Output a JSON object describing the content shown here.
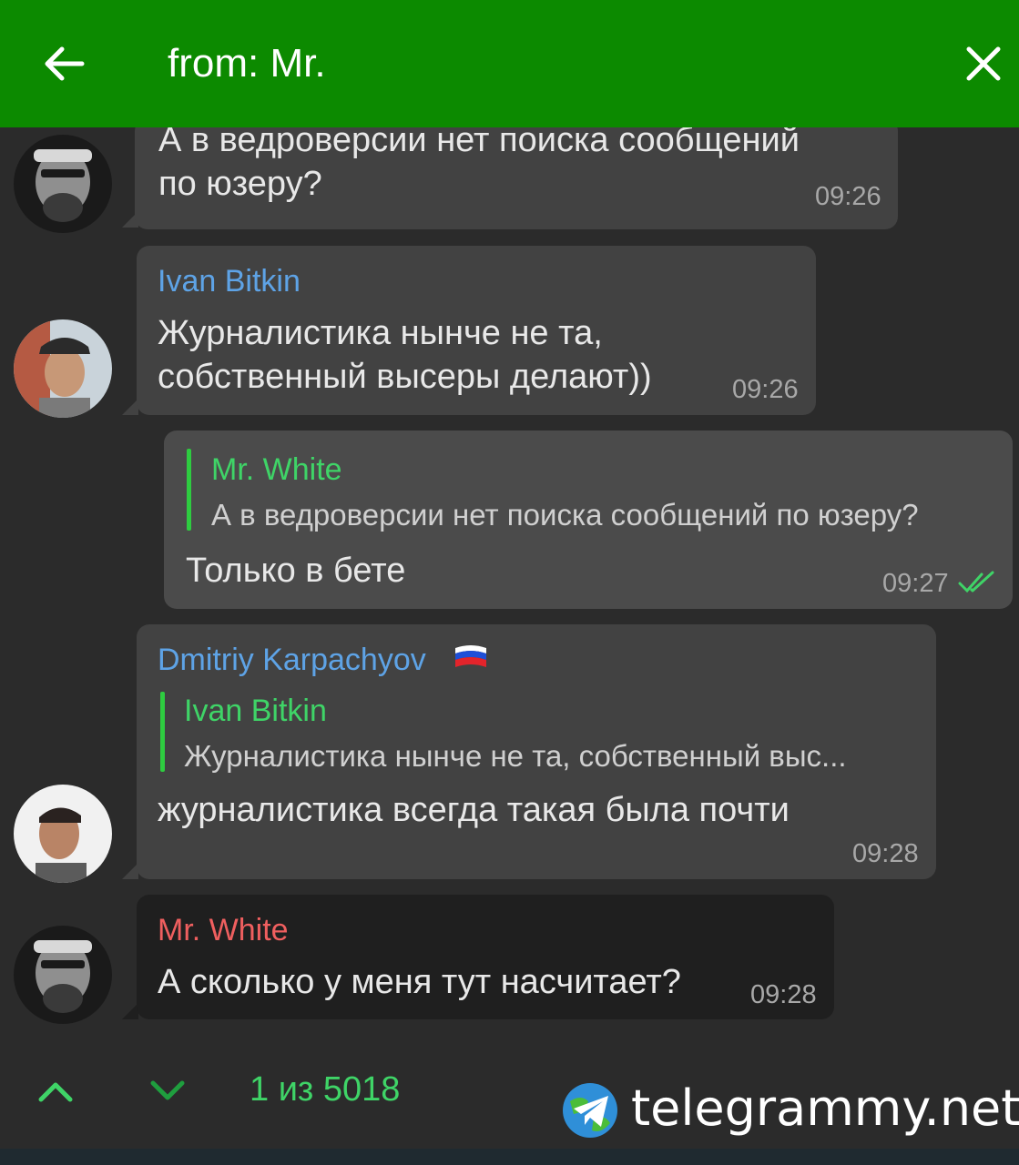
{
  "header": {
    "search_value": "from: Mr.",
    "back_icon": "arrow-left-icon",
    "close_icon": "close-icon",
    "background": "#0c8a00"
  },
  "messages": [
    {
      "text_line1": "А в ведроверсии нет поиска сообщений",
      "text_line2": "по юзеру?",
      "time": "09:26"
    },
    {
      "sender": "Ivan Bitkin",
      "text_line1": "Журналистика нынче не та,",
      "text_line2": "собственный высеры делают))",
      "time": "09:26"
    },
    {
      "reply_name": "Mr. White",
      "reply_text": "А в ведроверсии нет поиска сообщений по юзеру?",
      "text": "Только в бете",
      "time": "09:27",
      "status_icon": "double-check-icon"
    },
    {
      "sender": "Dmitriy Karpachyov",
      "sender_flag": "russia-flag-icon",
      "reply_name": "Ivan Bitkin",
      "reply_text": "Журналистика нынче не та, собственный выс...",
      "text": "журналистика всегда такая была почти",
      "time": "09:28"
    },
    {
      "sender": "Mr. White",
      "text": "А сколько у меня тут насчитает?",
      "time": "09:28"
    }
  ],
  "bottom": {
    "up_icon": "chevron-up-icon",
    "down_icon": "chevron-down-icon",
    "counter": "1 из 5018",
    "brand": "telegrammy.net"
  },
  "colors": {
    "accent_green": "#3fd467",
    "link_blue": "#5ea3e6",
    "name_red": "#ef5f5f",
    "bubble": "#424242",
    "background": "#2b2b2b"
  }
}
